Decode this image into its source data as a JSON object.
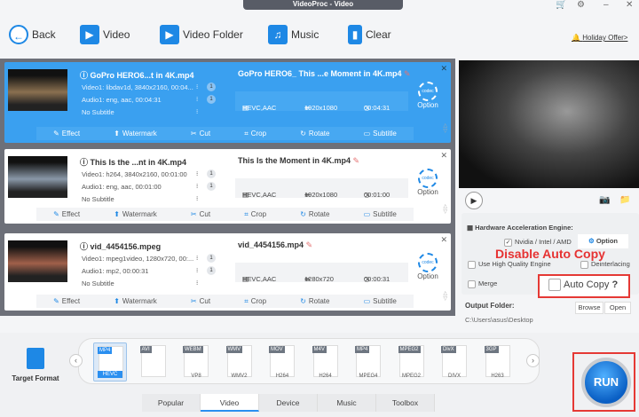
{
  "window": {
    "title": "VideoProc - Video"
  },
  "toolbar": {
    "back": "Back",
    "video": "Video",
    "video_folder": "Video Folder",
    "music": "Music",
    "clear": "Clear",
    "holiday": "Holiday Offer>"
  },
  "items": [
    {
      "name": "GoPro HERO6...t in 4K.mp4",
      "video": "Video1: libdav1d, 3840x2160, 00:04...",
      "audio": "Audio1: eng, aac, 00:04:31",
      "subtitle": "No Subtitle",
      "vcount": "1",
      "acount": "1",
      "out_name": "GoPro HERO6_ This ...e Moment in 4K.mp4",
      "codec": "HEVC,AAC",
      "res": "1920x1080",
      "dur": "00:04:31",
      "selected": true,
      "thumb": "#8a7050"
    },
    {
      "name": "This Is the ...nt in 4K.mp4",
      "video": "Video1: h264, 3840x2160, 00:01:00",
      "audio": "Audio1: eng, aac, 00:01:00",
      "subtitle": "No Subtitle",
      "vcount": "1",
      "acount": "1",
      "out_name": "This Is the Moment in 4K.mp4",
      "codec": "HEVC,AAC",
      "res": "1920x1080",
      "dur": "00:01:00",
      "selected": false,
      "thumb": "#8a98a8"
    },
    {
      "name": "vid_4454156.mpeg",
      "video": "Video1: mpeg1video, 1280x720, 00:...",
      "audio": "Audio1: mp2, 00:00:31",
      "subtitle": "No Subtitle",
      "vcount": "1",
      "acount": "1",
      "out_name": "vid_4454156.mp4",
      "codec": "HEVC,AAC",
      "res": "1280x720",
      "dur": "00:00:31",
      "selected": false,
      "thumb": "#a0604a"
    }
  ],
  "item_actions": [
    "Effect",
    "Watermark",
    "Cut",
    "Crop",
    "Rotate",
    "Subtitle"
  ],
  "option_label": "Option",
  "codec_label": "codec",
  "settings": {
    "hw_title": "Hardware Acceleration Engine:",
    "nvidia": "Nvidia / Intel / AMD",
    "option": "Option",
    "high_quality": "Use High Quality Engine",
    "deinterlacing": "Deinterlacing",
    "merge": "Merge",
    "auto_copy": "Auto Copy",
    "help": "?",
    "output_folder": "Output Folder:",
    "path": "C:\\Users\\asus\\Desktop",
    "browse": "Browse",
    "open": "Open"
  },
  "annotation": "Disable Auto Copy",
  "target_format": "Target Format",
  "formats": [
    {
      "top": "MP4",
      "bottom": "HEVC",
      "selected": true
    },
    {
      "top": "AVI",
      "bottom": ""
    },
    {
      "top": "WEBM",
      "bottom": "VP8"
    },
    {
      "top": "WMV",
      "bottom": "WMV2"
    },
    {
      "top": "MOV",
      "bottom": "H264"
    },
    {
      "top": "M4V",
      "bottom": "H264"
    },
    {
      "top": "MP4",
      "bottom": "MPEG4"
    },
    {
      "top": "MPEG2",
      "bottom": "MPEG2"
    },
    {
      "top": "DivX",
      "bottom": "DIVX"
    },
    {
      "top": "3GP",
      "bottom": "H263"
    }
  ],
  "tabs": [
    "Popular",
    "Video",
    "Device",
    "Music",
    "Toolbox"
  ],
  "active_tab": "Video",
  "run": "RUN",
  "colors": {
    "accent": "#1e88e5",
    "highlight": "#e53935"
  }
}
